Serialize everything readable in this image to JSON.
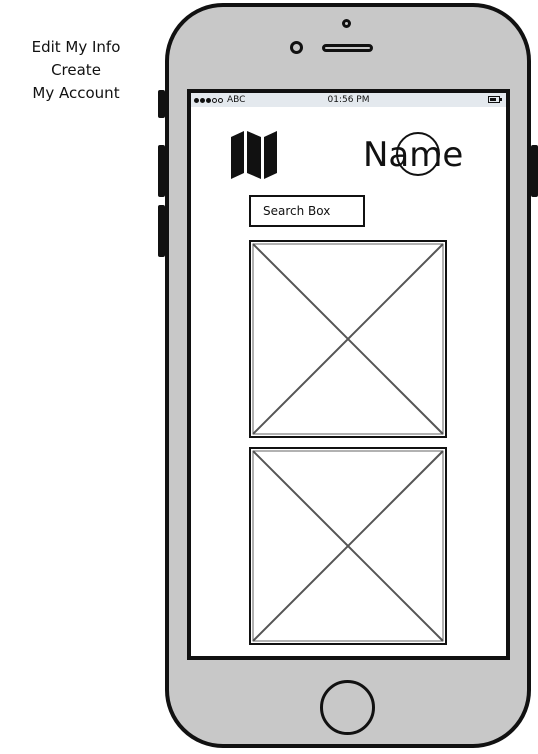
{
  "side_menu": {
    "line1": "Edit My Info",
    "line2": "Create",
    "line3": "My Account"
  },
  "status_bar": {
    "carrier": "ABC",
    "time": "01:56 PM"
  },
  "header": {
    "title": "Name",
    "map_icon": "map-icon"
  },
  "search": {
    "placeholder": "Search Box"
  },
  "images": [
    {
      "icon": "image-placeholder-icon"
    },
    {
      "icon": "image-placeholder-icon"
    }
  ]
}
